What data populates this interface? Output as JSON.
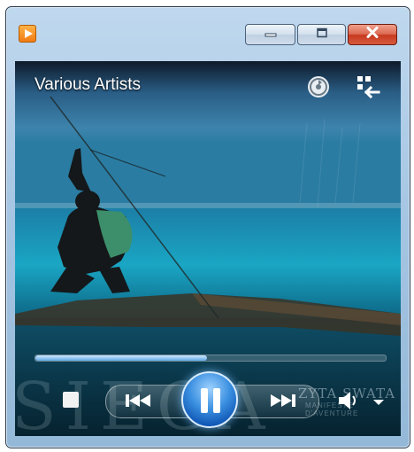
{
  "window": {
    "app_icon": "media-player-icon",
    "buttons": {
      "minimize": "minimize-icon",
      "maximize": "maximize-icon",
      "close": "close-icon"
    }
  },
  "now_playing": {
    "artist": "Various Artists",
    "album_art_watermark": "ZYTA SWATA",
    "album_art_watermark_sub": "MANIFESTE D'AVENTURE"
  },
  "playback": {
    "progress": 0.49,
    "state": "playing"
  },
  "controls": {
    "stop": "stop-icon",
    "previous": "previous-icon",
    "play_pause": "pause-icon",
    "next": "next-icon",
    "volume": "volume-icon",
    "volume_menu": "dropdown-arrow-icon",
    "switch_to_library": "switch-to-library-icon",
    "sync": "sync-icon"
  },
  "colors": {
    "accent": "#3a8fe0",
    "close_red": "#c63a20",
    "titlebar": "#a6c6e3"
  }
}
